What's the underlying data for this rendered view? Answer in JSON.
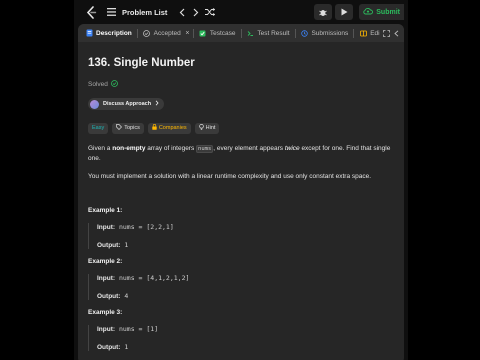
{
  "nav": {
    "problem_list": "Problem List",
    "submit_label": "Submit"
  },
  "tabs": [
    {
      "label": "Description",
      "active": true
    },
    {
      "label": "Accepted"
    },
    {
      "label": "Testcase"
    },
    {
      "label": "Test Result"
    },
    {
      "label": "Submissions"
    },
    {
      "label": "Edi"
    }
  ],
  "problem": {
    "title": "136. Single Number",
    "status": "Solved",
    "discuss": "Discuss Approach",
    "difficulty": "Easy",
    "topics": "Topics",
    "companies": "Companies",
    "hint": "Hint",
    "para1": {
      "a": "Given a ",
      "b": "non-empty",
      "c": " array of integers ",
      "code": "nums",
      "d": ", every element appears ",
      "e": "twice",
      "f": " except for one. Find that single one."
    },
    "para2": "You must implement a solution with a linear runtime complexity and use only constant extra space."
  },
  "examples": [
    {
      "title": "Example 1:",
      "input_label": "Input:",
      "input": "nums = [2,2,1]",
      "output_label": "Output:",
      "output": "1"
    },
    {
      "title": "Example 2:",
      "input_label": "Input:",
      "input": "nums = [4,1,2,1,2]",
      "output_label": "Output:",
      "output": "4"
    },
    {
      "title": "Example 3:",
      "input_label": "Input:",
      "input": "nums = [1]",
      "output_label": "Output:",
      "output": "1"
    }
  ],
  "colors": {
    "accent_green": "#2cbb5d",
    "easy": "#1cb8b8",
    "companies": "#ffb800",
    "panel": "#262626"
  }
}
